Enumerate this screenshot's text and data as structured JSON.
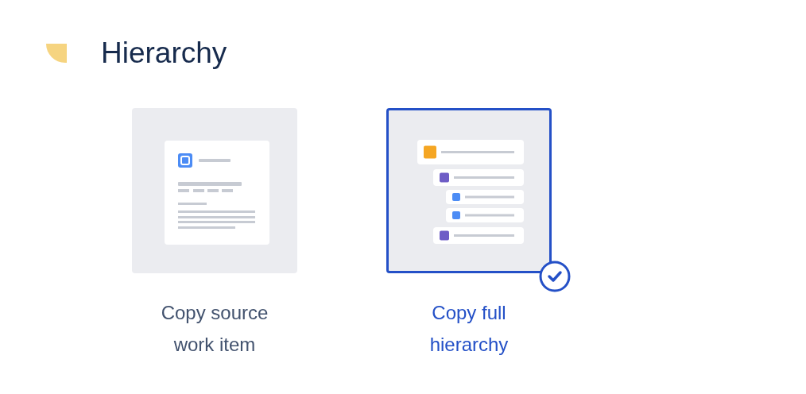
{
  "section": {
    "title": "Hierarchy"
  },
  "options": [
    {
      "label": "Copy source work item",
      "kind": "single",
      "selected": false
    },
    {
      "label": "Copy full hierarchy",
      "kind": "hierarchy",
      "selected": true
    }
  ]
}
